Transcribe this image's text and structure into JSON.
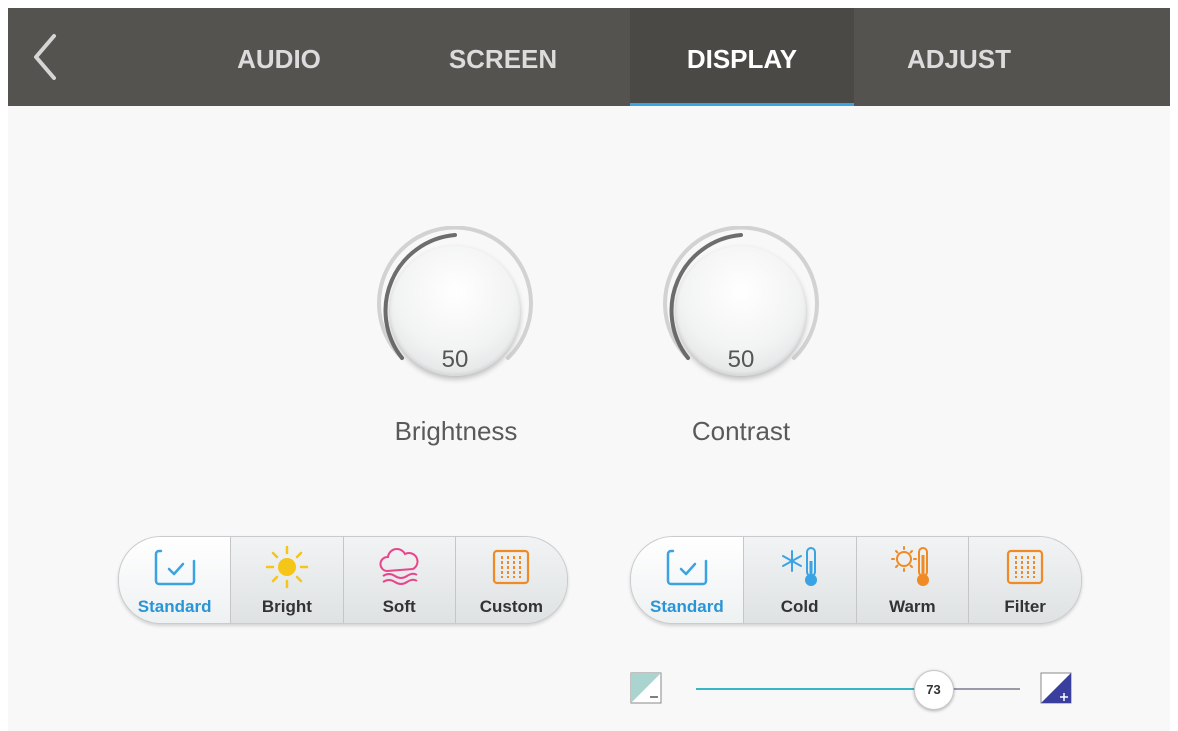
{
  "tabs": [
    {
      "label": "AUDIO",
      "active": false
    },
    {
      "label": "SCREEN",
      "active": false
    },
    {
      "label": "DISPLAY",
      "active": true
    },
    {
      "label": "ADJUST",
      "active": false
    }
  ],
  "dials": {
    "brightness": {
      "label": "Brightness",
      "value": "50"
    },
    "contrast": {
      "label": "Contrast",
      "value": "50"
    }
  },
  "picture_modes": {
    "selected": "Standard",
    "items": [
      {
        "label": "Standard",
        "icon": "standard-check-icon"
      },
      {
        "label": "Bright",
        "icon": "sun-icon"
      },
      {
        "label": "Soft",
        "icon": "cloud-icon"
      },
      {
        "label": "Custom",
        "icon": "custom-sliders-icon"
      }
    ]
  },
  "color_temps": {
    "selected": "Standard",
    "items": [
      {
        "label": "Standard",
        "icon": "standard-check-icon"
      },
      {
        "label": "Cold",
        "icon": "cold-thermometer-icon"
      },
      {
        "label": "Warm",
        "icon": "warm-thermometer-icon"
      },
      {
        "label": "Filter",
        "icon": "filter-sliders-icon"
      }
    ]
  },
  "filter_slider": {
    "value": "73",
    "fraction": 0.73
  },
  "colors": {
    "accent": "#3aa3e3",
    "topbar": "#555350",
    "bright_icon": "#f5c518",
    "soft_icon": "#e6468c",
    "custom_icon": "#f08a24",
    "cold_icon": "#3aa3e3",
    "warm_icon": "#f08a24",
    "slider_track_active": "#36b8c4",
    "slider_track_rest": "#9a9aa8"
  }
}
